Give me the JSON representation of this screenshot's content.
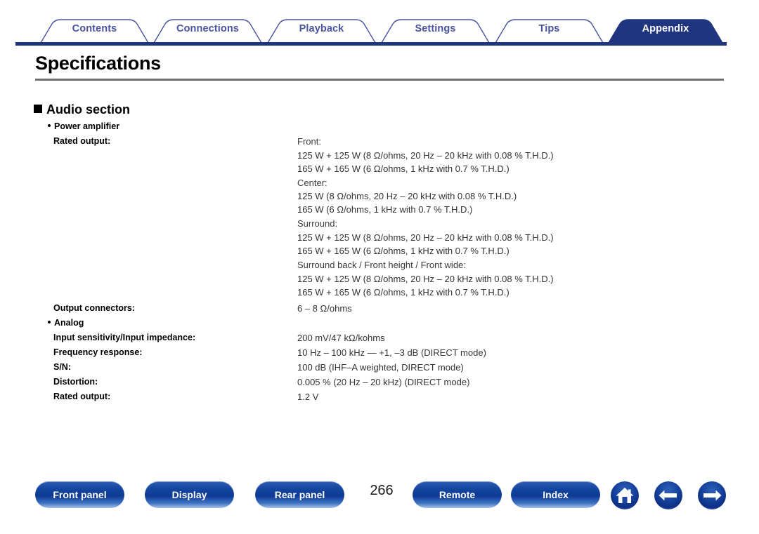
{
  "document": {
    "title": "Specifications",
    "page_number": "266"
  },
  "tabs": [
    {
      "label": "Contents",
      "active": false
    },
    {
      "label": "Connections",
      "active": false
    },
    {
      "label": "Playback",
      "active": false
    },
    {
      "label": "Settings",
      "active": false
    },
    {
      "label": "Tips",
      "active": false
    },
    {
      "label": "Appendix",
      "active": true
    }
  ],
  "sections": [
    {
      "heading": "Audio section",
      "subsections": [
        {
          "sub_heading": "Power amplifier",
          "rows": [
            {
              "label": "Rated output:",
              "values": [
                "Front:",
                "125 W + 125 W (8 Ω/ohms, 20 Hz – 20 kHz with 0.08 % T.H.D.)",
                "165 W + 165 W (6 Ω/ohms, 1 kHz with 0.7 % T.H.D.)",
                "Center:",
                "125 W (8 Ω/ohms, 20 Hz – 20 kHz with 0.08 % T.H.D.)",
                "165 W (6 Ω/ohms, 1 kHz with 0.7 % T.H.D.)",
                "Surround:",
                "125 W + 125 W (8 Ω/ohms, 20 Hz – 20 kHz with 0.08 % T.H.D.)",
                "165 W + 165 W (6 Ω/ohms, 1 kHz with 0.7 % T.H.D.)",
                "Surround back / Front height / Front wide:",
                "125 W + 125 W (8 Ω/ohms, 20 Hz – 20 kHz with 0.08 % T.H.D.)",
                "165 W + 165 W (6 Ω/ohms, 1 kHz with 0.7 % T.H.D.)"
              ]
            },
            {
              "label": "Output connectors:",
              "values": [
                "6 – 8 Ω/ohms"
              ]
            }
          ]
        },
        {
          "sub_heading": "Analog",
          "rows": [
            {
              "label": "Input sensitivity/Input impedance:",
              "values": [
                "200 mV/47 kΩ/kohms"
              ]
            },
            {
              "label": "Frequency response:",
              "values": [
                "10 Hz – 100 kHz — +1, –3 dB (DIRECT mode)"
              ]
            },
            {
              "label": "S/N:",
              "values": [
                "100 dB (IHF–A weighted, DIRECT mode)"
              ]
            },
            {
              "label": "Distortion:",
              "values": [
                "0.005 % (20 Hz – 20 kHz) (DIRECT mode)"
              ]
            },
            {
              "label": "Rated output:",
              "values": [
                "1.2 V"
              ]
            }
          ]
        }
      ]
    }
  ],
  "footer": {
    "buttons": [
      {
        "label": "Front panel",
        "name": "front-panel-button"
      },
      {
        "label": "Display",
        "name": "display-button"
      },
      {
        "label": "Rear panel",
        "name": "rear-panel-button"
      },
      {
        "label": "Remote",
        "name": "remote-button"
      },
      {
        "label": "Index",
        "name": "index-button"
      }
    ],
    "icon_buttons": [
      {
        "icon": "home-icon",
        "name": "home-button"
      },
      {
        "icon": "arrow-left-icon",
        "name": "previous-page-button"
      },
      {
        "icon": "arrow-right-icon",
        "name": "next-page-button"
      }
    ]
  },
  "colors": {
    "tab_active_bg": "#1f357f",
    "tab_inactive_text": "#49539e",
    "rule": "#6f6f6f",
    "button_blue": "#14459f"
  }
}
